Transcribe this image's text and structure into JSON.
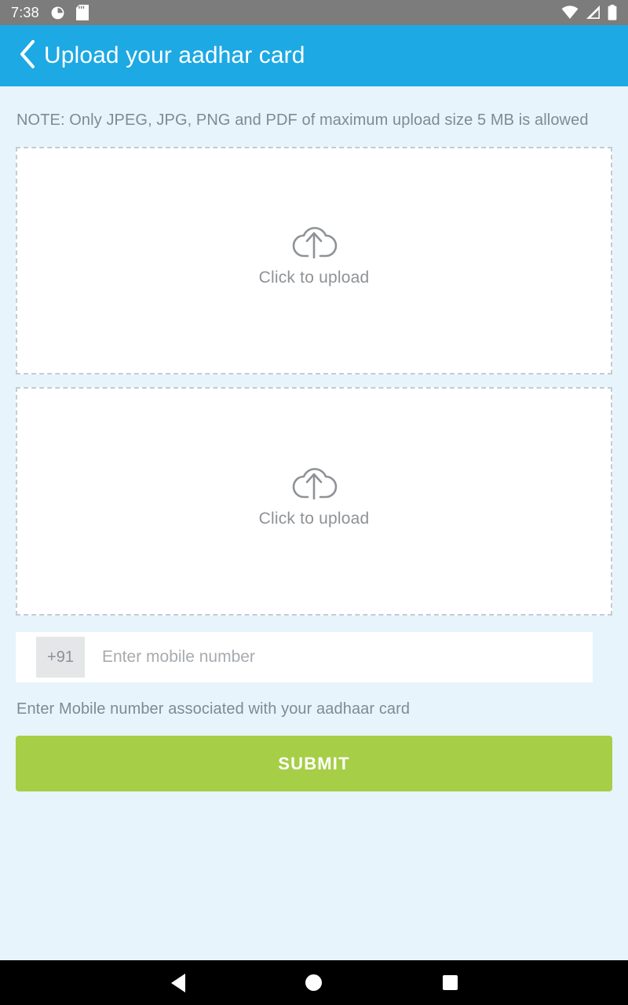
{
  "status_bar": {
    "time": "7:38",
    "left_icons": [
      "brightness-icon",
      "sd-card-icon"
    ],
    "right_icons": [
      "wifi-icon",
      "cellular-signal-icon",
      "battery-icon"
    ],
    "background_color": "#7c7c7c"
  },
  "header": {
    "title": "Upload your aadhar card",
    "back_icon": "chevron-left-icon",
    "background_color": "#1da9e3",
    "text_color": "#ffffff"
  },
  "main": {
    "note": "NOTE: Only JPEG, JPG, PNG and PDF of maximum upload size 5 MB is allowed",
    "upload_slots": [
      {
        "label": "Click to upload",
        "icon": "cloud-upload-icon"
      },
      {
        "label": "Click to upload",
        "icon": "cloud-upload-icon"
      }
    ],
    "phone": {
      "country_code": "+91",
      "placeholder": "Enter mobile number",
      "value": ""
    },
    "helper_text": "Enter Mobile number associated with your aadhaar card",
    "submit_label": "SUBMIT",
    "submit_color": "#a6ce47",
    "background_color": "#e7f4fb"
  },
  "nav_bar": {
    "back_label": "back-triangle",
    "home_label": "home-circle",
    "recents_label": "recents-square",
    "background_color": "#000000"
  }
}
